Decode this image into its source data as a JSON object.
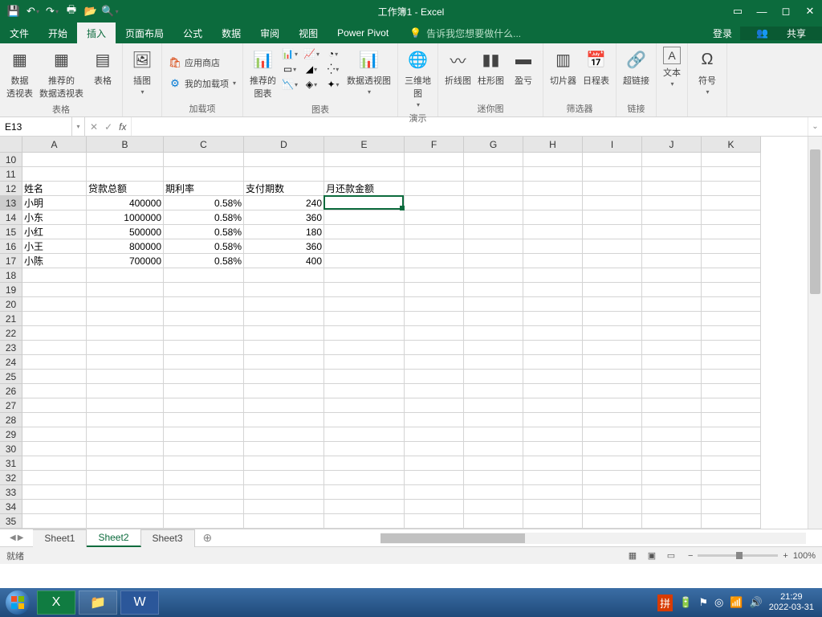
{
  "title": "工作簿1 - Excel",
  "menu": {
    "file": "文件",
    "home": "开始",
    "insert": "插入",
    "layout": "页面布局",
    "formula": "公式",
    "data": "数据",
    "review": "审阅",
    "view": "视图",
    "powerpivot": "Power Pivot",
    "tellme": "告诉我您想要做什么...",
    "login": "登录",
    "share": "共享"
  },
  "ribbon": {
    "pivot_table": "数据\n透视表",
    "recommended_pivot": "推荐的\n数据透视表",
    "table": "表格",
    "tables_label": "表格",
    "illustrations": "插图",
    "app_store": "应用商店",
    "my_addins": "我的加载项",
    "addins_label": "加载项",
    "recommended_charts": "推荐的\n图表",
    "pivot_chart": "数据透视图",
    "charts_label": "图表",
    "map3d": "三维地\n图",
    "tours_label": "演示",
    "sparkline_line": "折线图",
    "sparkline_column": "柱形图",
    "sparkline_winloss": "盈亏",
    "sparklines_label": "迷你图",
    "slicer": "切片器",
    "timeline": "日程表",
    "filters_label": "筛选器",
    "hyperlink": "超链接",
    "links_label": "链接",
    "text": "文本",
    "symbol": "符号"
  },
  "namebox": "E13",
  "formula": "",
  "columns": [
    "A",
    "B",
    "C",
    "D",
    "E",
    "F",
    "G",
    "H",
    "I",
    "J",
    "K"
  ],
  "row_start": 10,
  "row_end": 35,
  "selected": {
    "col": "E",
    "row": 13
  },
  "sheet_data": {
    "headers_row": 12,
    "headers": [
      "姓名",
      "贷款总额",
      "期利率",
      "支付期数",
      "月还款金额"
    ],
    "rows": [
      {
        "r": 13,
        "name": "小明",
        "loan": "400000",
        "rate": "0.58%",
        "periods": "240",
        "repay": ""
      },
      {
        "r": 14,
        "name": "小东",
        "loan": "1000000",
        "rate": "0.58%",
        "periods": "360",
        "repay": ""
      },
      {
        "r": 15,
        "name": "小红",
        "loan": "500000",
        "rate": "0.58%",
        "periods": "180",
        "repay": ""
      },
      {
        "r": 16,
        "name": "小王",
        "loan": "800000",
        "rate": "0.58%",
        "periods": "360",
        "repay": ""
      },
      {
        "r": 17,
        "name": "小陈",
        "loan": "700000",
        "rate": "0.58%",
        "periods": "400",
        "repay": ""
      }
    ]
  },
  "sheets": [
    "Sheet1",
    "Sheet2",
    "Sheet3"
  ],
  "active_sheet": "Sheet2",
  "status": "就绪",
  "zoom": "100%",
  "taskbar": {
    "time": "21:29",
    "date": "2022-03-31"
  }
}
